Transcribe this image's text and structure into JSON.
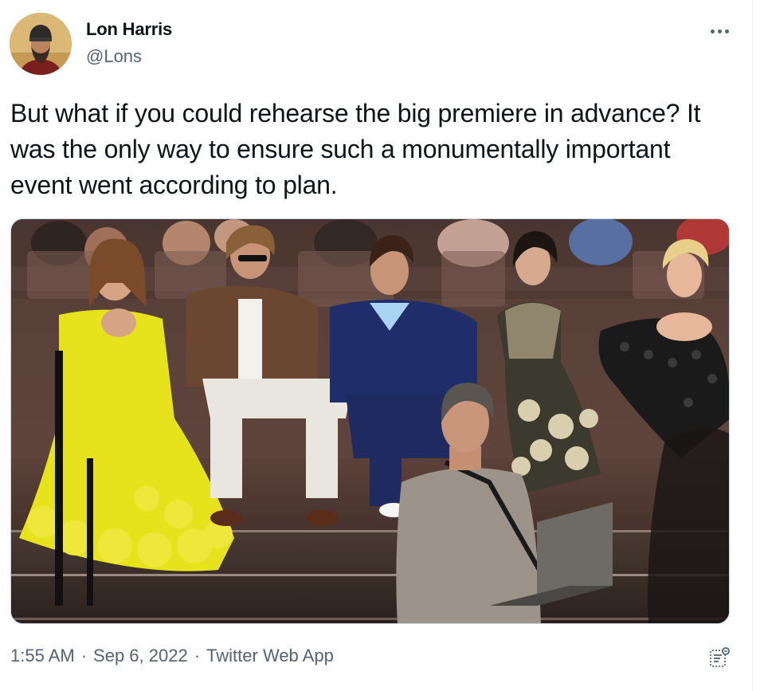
{
  "author": {
    "display_name": "Lon Harris",
    "handle": "@Lons",
    "avatar_icon": "avatar-photo"
  },
  "tweet": {
    "text": "But what if you could rehearse the big premiere in advance? It was the only way to ensure such a monumentally important event went according to plan.",
    "media": {
      "kind": "photo",
      "icon": "premiere-photo"
    }
  },
  "footer": {
    "time": "1:55 AM",
    "date": "Sep 6, 2022",
    "separator": "·",
    "source": "Twitter Web App",
    "analytics_icon": "analytics-icon"
  },
  "menu": {
    "more_icon": "more-dots-icon"
  },
  "colors": {
    "text_primary": "#0f1419",
    "text_secondary": "#536471",
    "border": "#cfd9de"
  }
}
